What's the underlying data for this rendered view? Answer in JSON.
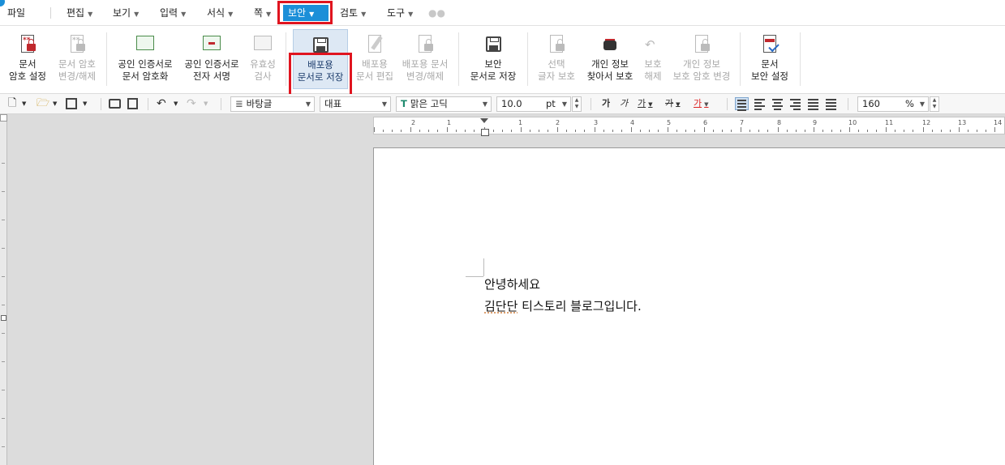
{
  "menu": {
    "file": "파일",
    "edit": "편집",
    "view": "보기",
    "input": "입력",
    "format": "서식",
    "page": "쪽",
    "security": "보안",
    "review": "검토",
    "tools": "도구"
  },
  "ribbon": {
    "doc_password": [
      "문서",
      "암호 설정"
    ],
    "change_password": [
      "문서 암호",
      "변경/해제"
    ],
    "cert_encrypt": [
      "공인 인증서로",
      "문서 암호화"
    ],
    "cert_sign": [
      "공인 인증서로",
      "전자 서명"
    ],
    "validity": [
      "유효성",
      "검사"
    ],
    "dist_save": [
      "배포용",
      "문서로 저장"
    ],
    "dist_edit": [
      "배포용",
      "문서 편집"
    ],
    "dist_change": [
      "배포용 문서",
      "변경/해제"
    ],
    "secure_save": [
      "보안",
      "문서로 저장"
    ],
    "char_protect": [
      "선택",
      "글자 보호"
    ],
    "find_protect": [
      "개인 정보",
      "찾아서 보호"
    ],
    "unprotect": [
      "보호",
      "해제"
    ],
    "privacy_pw": [
      "개인 정보",
      "보호 암호 변경"
    ],
    "doc_security": [
      "문서",
      "보안 설정"
    ]
  },
  "toolbar": {
    "style": "바탕글",
    "lang": "대표",
    "font": "맑은 고딕",
    "font_size": "10.0",
    "size_unit": "pt",
    "zoom": "160",
    "zoom_unit": "%",
    "bold": "가",
    "italic": "가",
    "underline": "가",
    "strike": "가",
    "color": "가"
  },
  "ruler": [
    "2",
    "1",
    "1",
    "2",
    "3",
    "4",
    "5",
    "6",
    "7",
    "8",
    "9",
    "10",
    "11",
    "12",
    "13",
    "14"
  ],
  "document": {
    "line1": "안녕하세요",
    "line2_word1": "김단단",
    "line2_rest": " 티스토리 블로그입니다."
  },
  "colors": {
    "active_menu": "#1b8fd8",
    "highlight_box": "#e0141f",
    "selected_button": "#dde8f4"
  }
}
